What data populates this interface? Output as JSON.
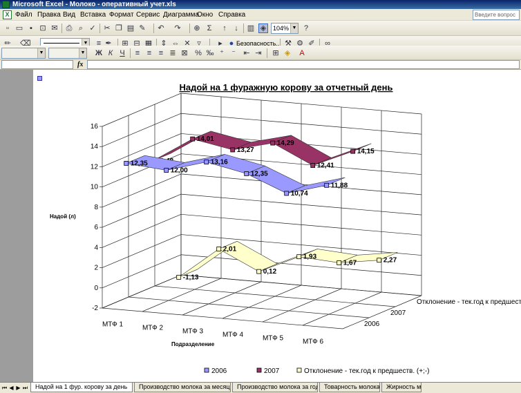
{
  "window": {
    "title": "Microsoft Excel - Молоко - оперативный учет.xls"
  },
  "menu": {
    "items": [
      "Файл",
      "Правка",
      "Вид",
      "Вставка",
      "Формат",
      "Сервис",
      "Диаграмма",
      "Окно",
      "Справка"
    ],
    "help_placeholder": "Введите вопрос"
  },
  "toolbar": {
    "zoom": "104%",
    "security_label": "Безопасность..."
  },
  "tabs": {
    "items": [
      {
        "label": "Надой на 1 фур. корову за день",
        "active": true
      },
      {
        "label": "Производство молока за месяц",
        "active": false
      },
      {
        "label": "Производство молока за год",
        "active": false
      },
      {
        "label": "Товарность молока",
        "active": false
      },
      {
        "label": "Жирность м",
        "active": false
      }
    ]
  },
  "colors": {
    "series_2006": "#9999ff",
    "series_2007": "#993366",
    "series_dev": "#ffffcc"
  },
  "chart_data": {
    "type": "line",
    "title": "Надой на 1 фуражную корову за отчетный день",
    "ylabel": "Надой (л)",
    "xlabel": "Подразделение",
    "categories": [
      "МТФ 1",
      "МТФ 2",
      "МТФ 3",
      "МТФ 4",
      "МТФ 5",
      "МТФ 6"
    ],
    "ylim": [
      -2,
      16
    ],
    "yticks": [
      "-2",
      "0",
      "2",
      "4",
      "6",
      "8",
      "10",
      "12",
      "14",
      "16"
    ],
    "depth_labels": [
      "Отклонение - тек.год к предшеств.   (+;-)",
      "2007",
      "2006"
    ],
    "series": [
      {
        "name": "2006",
        "values": [
          12.35,
          12.0,
          13.16,
          12.35,
          10.74,
          11.88
        ],
        "labels": [
          "12,35",
          "12,00",
          "13,16",
          "12,35",
          "10,74",
          "11,88"
        ]
      },
      {
        "name": "2007",
        "values": [
          11.48,
          14.01,
          13.27,
          14.29,
          12.41,
          14.15
        ],
        "labels": [
          "11,48",
          "14,01",
          "13,27",
          "14,29",
          "12,41",
          "14,15"
        ]
      },
      {
        "name": "Отклонение - тек.год к предшеств.   (+;-)",
        "values": [
          -1.13,
          2.01,
          0.12,
          1.93,
          1.67,
          2.27
        ],
        "labels": [
          "-1,13",
          "2,01",
          "0,12",
          "1,93",
          "1,67",
          "2,27"
        ]
      }
    ],
    "legend": {
      "position": "bottom",
      "entries": [
        "2006",
        "2007",
        "Отклонение - тек.год к предшеств.   (+;-)"
      ]
    },
    "grid": true
  }
}
